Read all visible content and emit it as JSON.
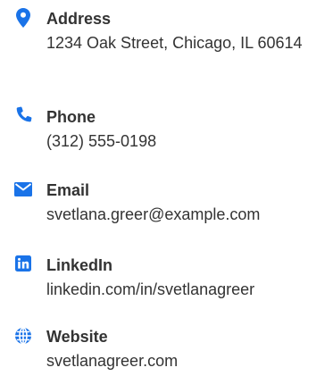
{
  "accent_color": "#1a73e8",
  "contacts": [
    {
      "icon": "map-marker-icon",
      "label": "Address",
      "value": "1234 Oak Street, Chicago, IL 60614"
    },
    {
      "icon": "phone-icon",
      "label": "Phone",
      "value": "(312) 555-0198"
    },
    {
      "icon": "envelope-icon",
      "label": "Email",
      "value": "svetlana.greer@example.com"
    },
    {
      "icon": "linkedin-icon",
      "label": "LinkedIn",
      "value": "linkedin.com/in/svetlanagreer"
    },
    {
      "icon": "globe-icon",
      "label": "Website",
      "value": "svetlanagreer.com"
    }
  ]
}
